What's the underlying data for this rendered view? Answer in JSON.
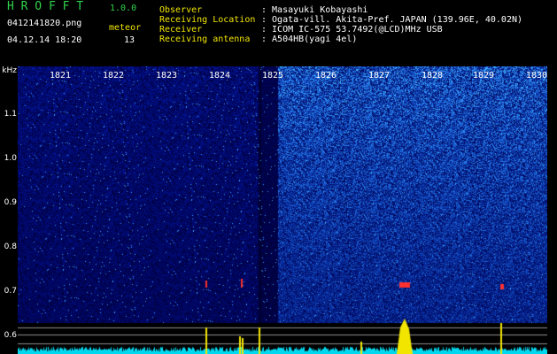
{
  "app": {
    "title": "H R O F F T",
    "version": "1.0.0"
  },
  "file": {
    "name": "0412141820.png",
    "timestamp": "04.12.14 18:20"
  },
  "meteor": {
    "label": "meteor",
    "count": "13"
  },
  "info": [
    {
      "key": "Observer",
      "value": ": Masayuki Kobayashi"
    },
    {
      "key": "Receiving Location",
      "value": ": Ogata-vill. Akita-Pref. JAPAN (139.96E, 40.02N)"
    },
    {
      "key": "Receiver",
      "value": ": ICOM IC-575 53.7492(@LCD)MHz USB"
    },
    {
      "key": "Receiving antenna",
      "value": ": A504HB(yagi 4el)"
    }
  ],
  "axis": {
    "unit": "kHz",
    "y_ticks": [
      "1.1",
      "1.0",
      "0.9",
      "0.8",
      "0.7",
      "0.6"
    ],
    "x_ticks": [
      "1821",
      "1822",
      "1823",
      "1824",
      "1825",
      "1826",
      "1827",
      "1828",
      "1829",
      "1830"
    ]
  },
  "colors": {
    "background": "#000000",
    "noise_dark": "#0b1a6e",
    "noise_bright": "#3fa0ff",
    "signal": "#ff3030",
    "meteor_echo": "#f2e600",
    "baseline": "#00e0ff"
  }
}
